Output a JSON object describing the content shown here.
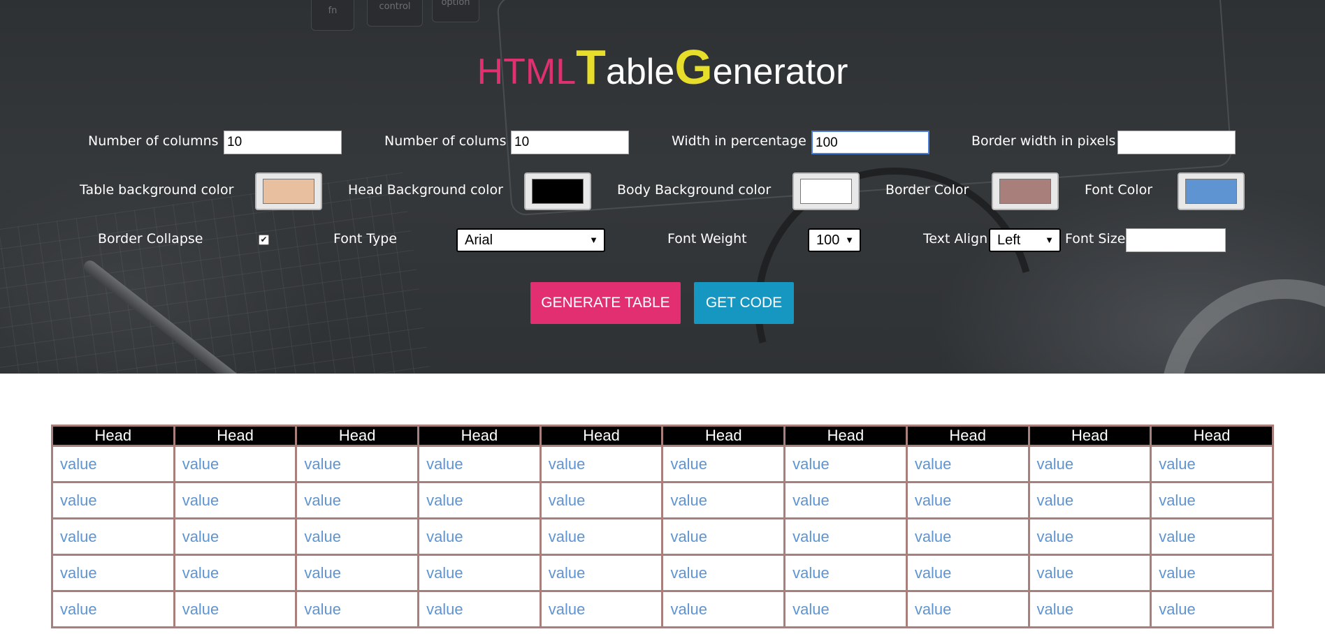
{
  "title": {
    "part1": "HTML",
    "part2_big": "T",
    "part2_rest": "able",
    "part3_big": "G",
    "part3_rest": "enerator"
  },
  "keyboard_keys": [
    "fn",
    "control",
    "option"
  ],
  "form": {
    "num_columns_label": "Number of columns",
    "num_columns_value": "10",
    "num_colums_label": "Number of colums",
    "num_colums_value": "10",
    "width_pct_label": "Width in percentage",
    "width_pct_value": "100",
    "border_width_label": "Border width in pixels",
    "border_width_value": "",
    "table_bg_label": "Table background color",
    "table_bg_color": "#e8c09f",
    "head_bg_label": "Head Background color",
    "head_bg_color": "#000000",
    "body_bg_label": "Body Background color",
    "body_bg_color": "#ffffff",
    "border_color_label": "Border Color",
    "border_color": "#a87f7a",
    "font_color_label": "Font Color",
    "font_color": "#5e94d1",
    "border_collapse_label": "Border Collapse",
    "border_collapse_checked": true,
    "font_type_label": "Font Type",
    "font_type_value": "Arial",
    "font_weight_label": "Font Weight",
    "font_weight_value": "100",
    "text_align_label": "Text Align",
    "text_align_value": "Left",
    "font_size_label": "Font Size",
    "font_size_value": ""
  },
  "buttons": {
    "generate": "GENERATE TABLE",
    "get_code": "GET CODE"
  },
  "table": {
    "headers": [
      "Head",
      "Head",
      "Head",
      "Head",
      "Head",
      "Head",
      "Head",
      "Head",
      "Head",
      "Head"
    ],
    "rows": [
      [
        "value",
        "value",
        "value",
        "value",
        "value",
        "value",
        "value",
        "value",
        "value",
        "value"
      ],
      [
        "value",
        "value",
        "value",
        "value",
        "value",
        "value",
        "value",
        "value",
        "value",
        "value"
      ],
      [
        "value",
        "value",
        "value",
        "value",
        "value",
        "value",
        "value",
        "value",
        "value",
        "value"
      ],
      [
        "value",
        "value",
        "value",
        "value",
        "value",
        "value",
        "value",
        "value",
        "value",
        "value"
      ],
      [
        "value",
        "value",
        "value",
        "value",
        "value",
        "value",
        "value",
        "value",
        "value",
        "value"
      ]
    ]
  },
  "colors": {
    "accent_pink": "#e12f72",
    "accent_blue": "#1597c2",
    "title_yellow": "#e6de2a"
  }
}
